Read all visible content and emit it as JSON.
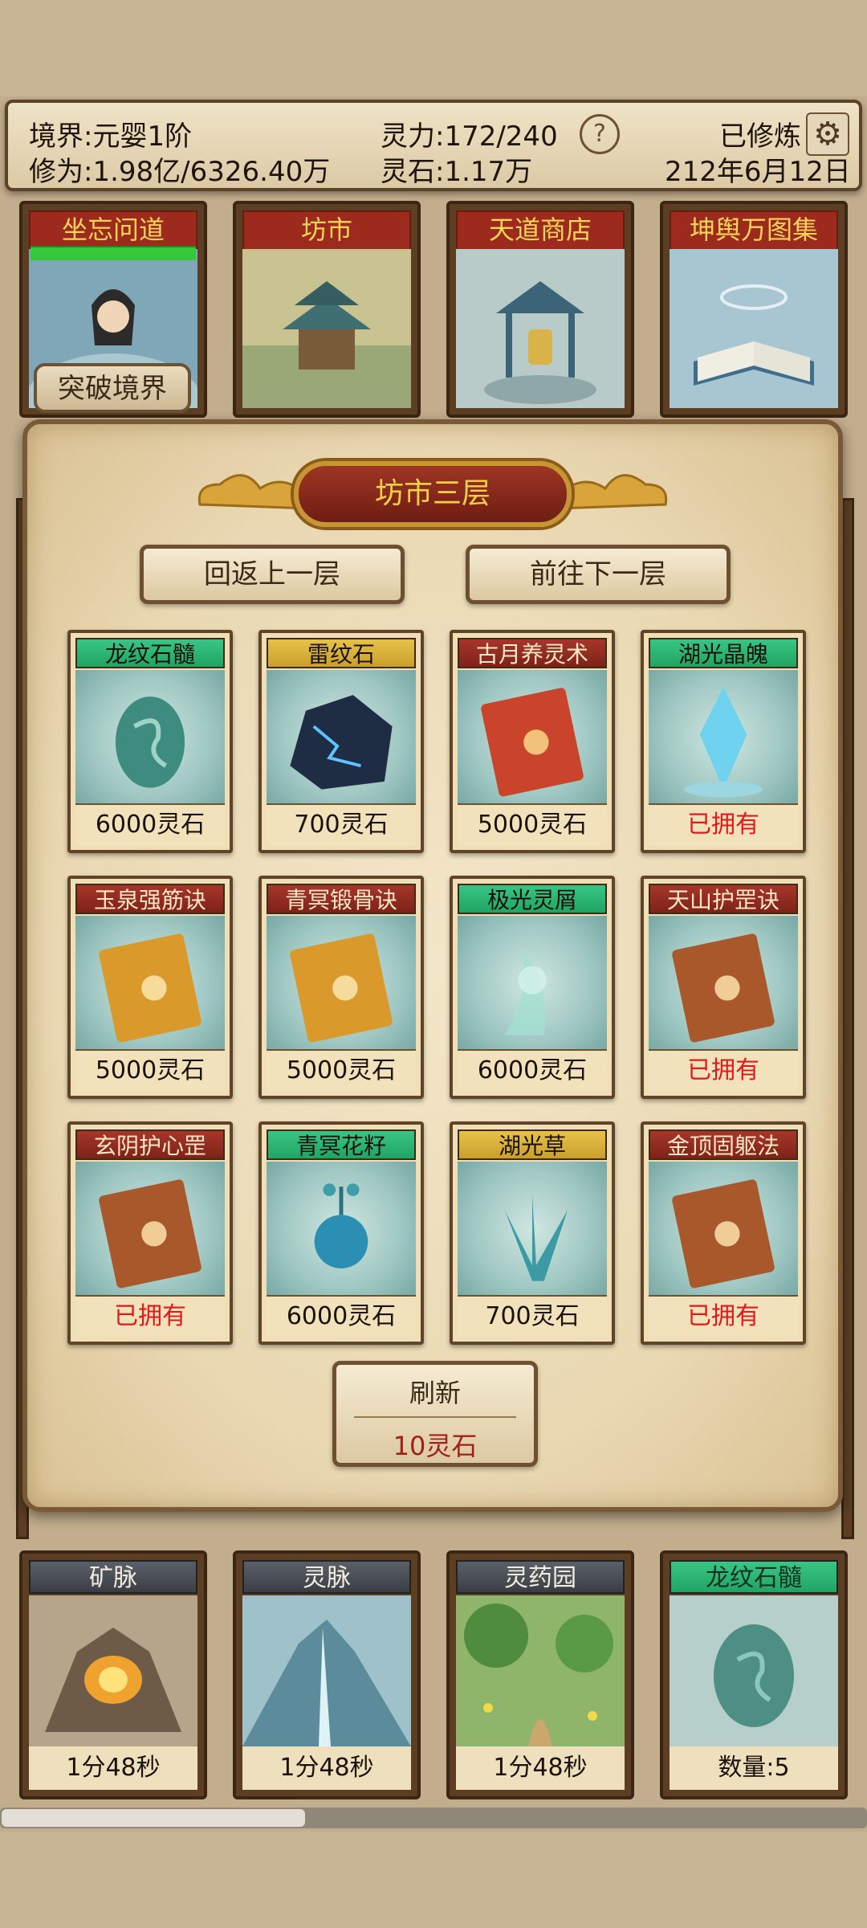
{
  "status": {
    "realm": "境界:元婴1阶",
    "cultivation": "修为:1.98亿/6326.40万",
    "spirit_power": "灵力:172/240",
    "spirit_stone": "灵石:1.17万",
    "cultivating": "已修炼",
    "date": "212年6月12日",
    "help": "?",
    "gear_icon": "⚙"
  },
  "locations": [
    {
      "title": "坐忘问道",
      "icon": "cultivator-portrait"
    },
    {
      "title": "坊市",
      "icon": "market-pagoda"
    },
    {
      "title": "天道商店",
      "icon": "pavilion-bell"
    },
    {
      "title": "坤舆万图集",
      "icon": "open-book"
    }
  ],
  "breakthrough_label": "突破境界",
  "panel": {
    "title": "坊市三层",
    "prev_floor": "回返上一层",
    "next_floor": "前往下一层",
    "items": [
      {
        "name": "龙纹石髓",
        "price": "6000灵石",
        "rarity": "green",
        "owned": false,
        "icon": "dragon-egg-icon"
      },
      {
        "name": "雷纹石",
        "price": "700灵石",
        "rarity": "gold",
        "owned": false,
        "icon": "thunder-rock-icon"
      },
      {
        "name": "古月养灵术",
        "price": "5000灵石",
        "rarity": "red",
        "owned": false,
        "icon": "red-book-icon"
      },
      {
        "name": "湖光晶魄",
        "price": "已拥有",
        "rarity": "green",
        "owned": true,
        "icon": "crystal-icon"
      },
      {
        "name": "玉泉强筋诀",
        "price": "5000灵石",
        "rarity": "red",
        "owned": false,
        "icon": "gold-book-icon"
      },
      {
        "name": "青冥锻骨诀",
        "price": "5000灵石",
        "rarity": "red",
        "owned": false,
        "icon": "gold-book-icon"
      },
      {
        "name": "极光灵屑",
        "price": "6000灵石",
        "rarity": "green",
        "owned": false,
        "icon": "aurora-dust-icon"
      },
      {
        "name": "天山护罡诀",
        "price": "已拥有",
        "rarity": "red",
        "owned": true,
        "icon": "brown-book-icon"
      },
      {
        "name": "玄阴护心罡",
        "price": "已拥有",
        "rarity": "red",
        "owned": true,
        "icon": "brown-book-icon"
      },
      {
        "name": "青冥花籽",
        "price": "6000灵石",
        "rarity": "green",
        "owned": false,
        "icon": "flower-seed-icon"
      },
      {
        "name": "湖光草",
        "price": "700灵石",
        "rarity": "gold",
        "owned": false,
        "icon": "grass-icon"
      },
      {
        "name": "金顶固躯法",
        "price": "已拥有",
        "rarity": "red",
        "owned": true,
        "icon": "brown-book-icon"
      }
    ],
    "refresh_label": "刷新",
    "refresh_cost": "10灵石"
  },
  "bottom_cards": [
    {
      "title": "矿脉",
      "foot": "1分48秒",
      "icon": "mine-icon"
    },
    {
      "title": "灵脉",
      "foot": "1分48秒",
      "icon": "spirit-vein-icon"
    },
    {
      "title": "灵药园",
      "foot": "1分48秒",
      "icon": "herb-garden-icon"
    },
    {
      "title": "龙纹石髓",
      "foot": "数量:5",
      "icon": "dragon-egg-icon"
    }
  ],
  "colors": {
    "owned": "#e0191d",
    "rarity_green": "#2bb573",
    "rarity_gold": "#d9b23b",
    "rarity_red": "#8e2a1f",
    "panel_title": "#f5d04b"
  }
}
